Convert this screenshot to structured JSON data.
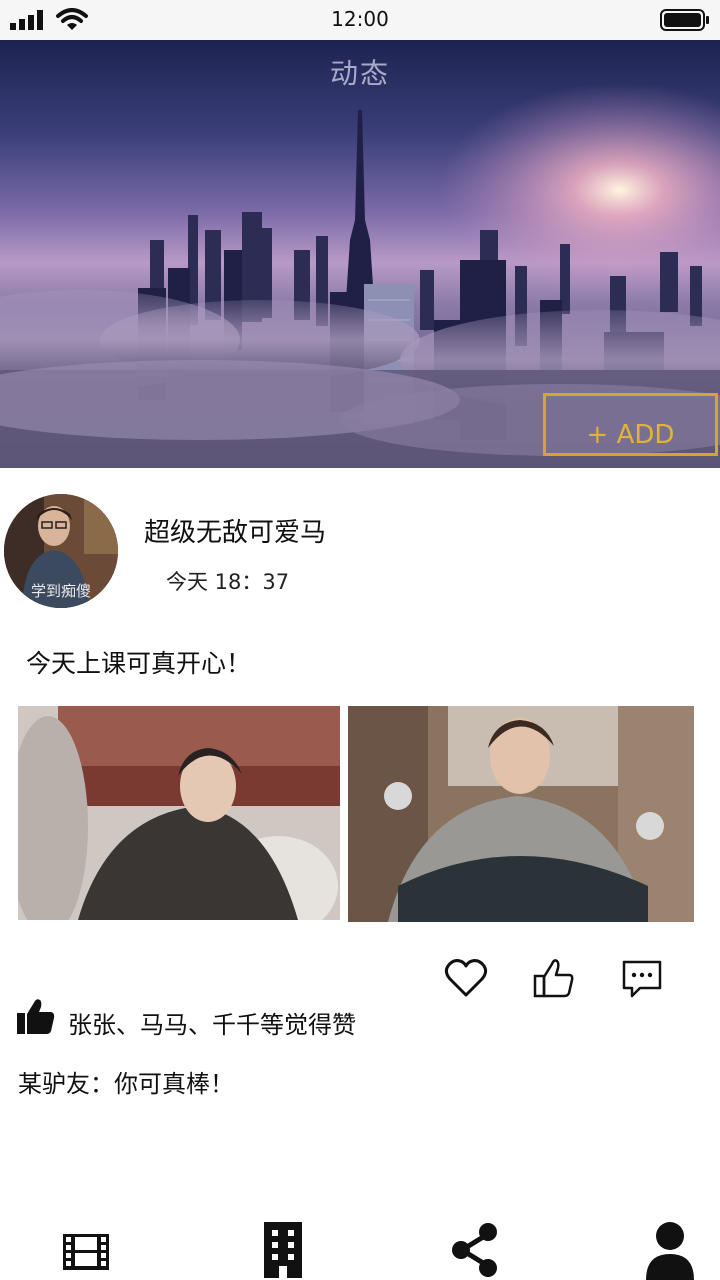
{
  "status_bar": {
    "time": "12:00"
  },
  "banner": {
    "title": "动态",
    "add_label": "+ ADD"
  },
  "post": {
    "avatar_caption": "学到痴傻",
    "username": "超级无敌可爱马",
    "time": "今天 18：37",
    "text": "今天上课可真开心！"
  },
  "actions": {
    "like_icon": "heart-icon",
    "thumb_icon": "thumbs-up-icon",
    "comment_icon": "comment-icon"
  },
  "likes": {
    "text": "张张、马马、千千等觉得赞"
  },
  "comments": [
    {
      "text": "某驴友：你可真棒！"
    }
  ],
  "nav": {
    "items": [
      {
        "icon": "film-icon"
      },
      {
        "icon": "building-icon"
      },
      {
        "icon": "share-icon"
      },
      {
        "icon": "user-icon"
      }
    ]
  },
  "colors": {
    "accent": "#d4a72c",
    "text": "#111111"
  }
}
